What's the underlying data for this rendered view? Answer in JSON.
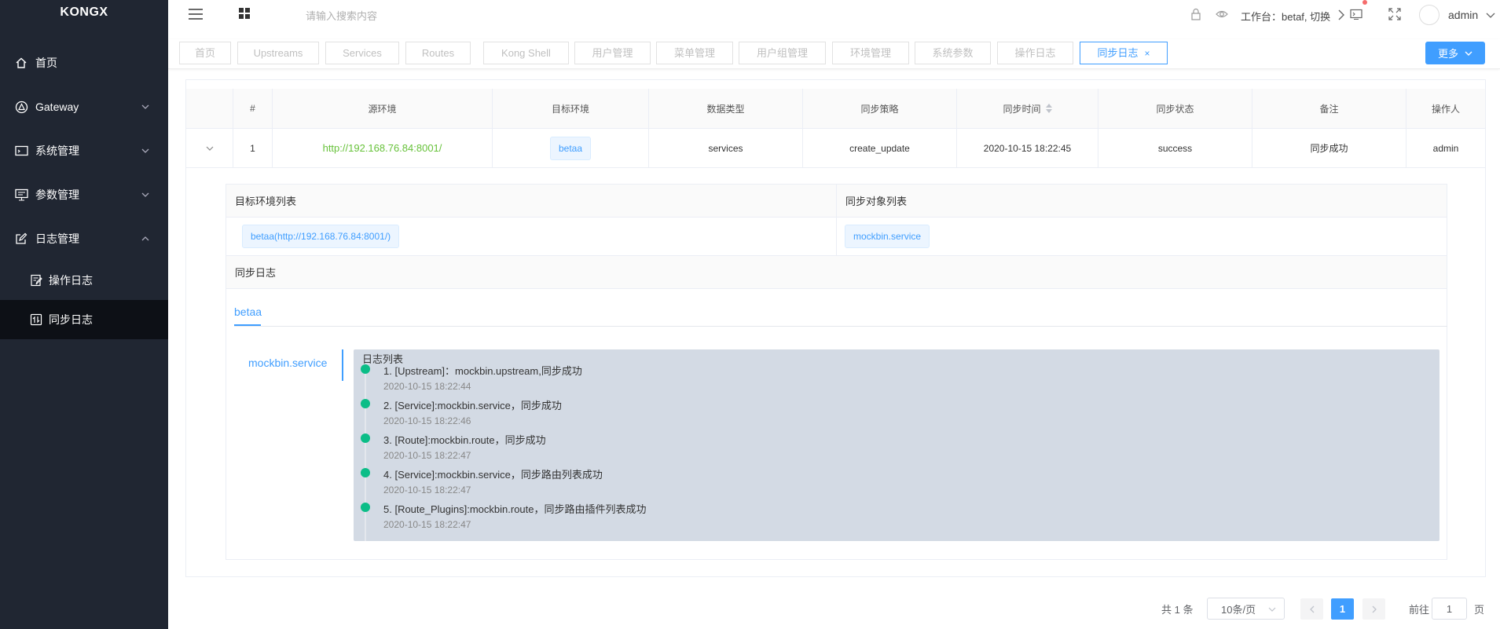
{
  "app": {
    "logo": "KONGX"
  },
  "sidebar": {
    "items": [
      {
        "label": "首页"
      },
      {
        "label": "Gateway"
      },
      {
        "label": "系统管理"
      },
      {
        "label": "参数管理"
      },
      {
        "label": "日志管理"
      }
    ],
    "sub_items": [
      {
        "label": "操作日志"
      },
      {
        "label": "同步日志"
      }
    ]
  },
  "header": {
    "search_placeholder": "请输入搜索内容",
    "workspace": "工作台：betaf, 切换",
    "user": "admin"
  },
  "tags": [
    {
      "label": "首页"
    },
    {
      "label": "Upstreams"
    },
    {
      "label": "Services"
    },
    {
      "label": "Routes"
    },
    {
      "label": "Kong Shell"
    },
    {
      "label": "用户管理"
    },
    {
      "label": "菜单管理"
    },
    {
      "label": "用户组管理"
    },
    {
      "label": "环境管理"
    },
    {
      "label": "系统参数"
    },
    {
      "label": "操作日志"
    },
    {
      "label": "同步日志",
      "close": "×"
    }
  ],
  "more_button": "更多",
  "table": {
    "headers": [
      "#",
      "源环境",
      "目标环境",
      "数据类型",
      "同步策略",
      "同步时间",
      "同步状态",
      "备注",
      "操作人"
    ],
    "row": {
      "index": "1",
      "source": "http://192.168.76.84:8001/",
      "target": "betaa",
      "data_type": "services",
      "strategy": "create_update",
      "sync_time": "2020-10-15 18:22:45",
      "status": "success",
      "remark": "同步成功",
      "operator": "admin"
    }
  },
  "detail": {
    "target_env_header": "目标环境列表",
    "sync_object_header": "同步对象列表",
    "target_env_tag": "betaa(http://192.168.76.84:8001/)",
    "sync_object_tag": "mockbin.service",
    "sync_log_header": "同步日志",
    "env_tab": "betaa",
    "object_tab": "mockbin.service",
    "log_title": "日志列表",
    "logs": [
      {
        "text": "1. [Upstream]：mockbin.upstream,同步成功",
        "time": "2020-10-15 18:22:44"
      },
      {
        "text": "2. [Service]:mockbin.service，同步成功",
        "time": "2020-10-15 18:22:46"
      },
      {
        "text": "3. [Route]:mockbin.route，同步成功",
        "time": "2020-10-15 18:22:47"
      },
      {
        "text": "4. [Service]:mockbin.service，同步路由列表成功",
        "time": "2020-10-15 18:22:47"
      },
      {
        "text": "5. [Route_Plugins]:mockbin.route，同步路由插件列表成功",
        "time": "2020-10-15 18:22:47"
      }
    ]
  },
  "pagination": {
    "total": "共 1 条",
    "page_size": "10条/页",
    "current_page": "1",
    "goto_label": "前往",
    "goto_value": "1",
    "page_suffix": "页"
  },
  "colors": {
    "sidebar_bg": "#202632",
    "accent": "#409eff",
    "success_dot": "#0bbd87",
    "link_green": "#67c23a",
    "log_bg": "#d3dae4"
  }
}
